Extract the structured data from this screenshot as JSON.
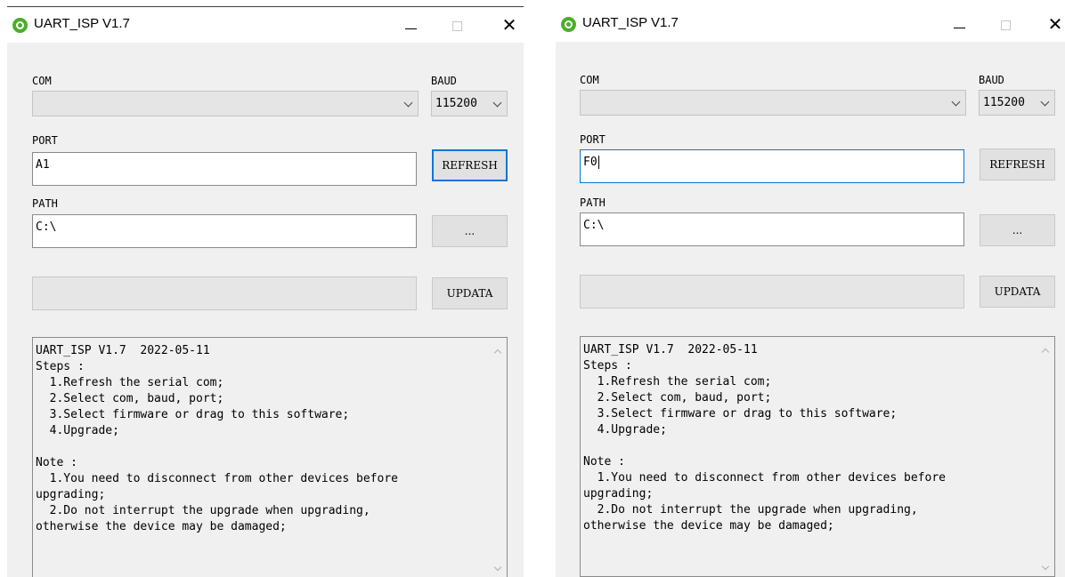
{
  "windows": [
    {
      "title": "UART_ISP V1.7",
      "com_label": "COM",
      "com_value": "",
      "baud_label": "BAUD",
      "baud_value": "115200",
      "port_label": "PORT",
      "port_value": "A1",
      "refresh_label": "REFRESH",
      "path_label": "PATH",
      "path_value": "C:\\",
      "browse_label": "...",
      "update_label": "UPDATA",
      "log": "UART_ISP V1.7  2022-05-11\nSteps :\n  1.Refresh the serial com;\n  2.Select com, baud, port;\n  3.Select firmware or drag to this software;\n  4.Upgrade;\n\nNote :\n  1.You need to disconnect from other devices before\nupgrading;\n  2.Do not interrupt the upgrade when upgrading,\notherwise the device may be damaged;"
    },
    {
      "title": "UART_ISP V1.7",
      "com_label": "COM",
      "com_value": "",
      "baud_label": "BAUD",
      "baud_value": "115200",
      "port_label": "PORT",
      "port_value": "F0",
      "refresh_label": "REFRESH",
      "path_label": "PATH",
      "path_value": "C:\\",
      "browse_label": "...",
      "update_label": "UPDATA",
      "log": "UART_ISP V1.7  2022-05-11\nSteps :\n  1.Refresh the serial com;\n  2.Select com, baud, port;\n  3.Select firmware or drag to this software;\n  4.Upgrade;\n\nNote :\n  1.You need to disconnect from other devices before\nupgrading;\n  2.Do not interrupt the upgrade when upgrading,\notherwise the device may be damaged;"
    }
  ],
  "colors": {
    "window_bg": "#f0f0f0",
    "focus_accent": "#0078d7",
    "app_icon": "#4cae2b"
  },
  "icons": {
    "app": "green-refresh-circle-icon",
    "minimize": "minimize-icon",
    "maximize": "maximize-icon",
    "close": "close-icon",
    "dropdown": "chevron-down-icon"
  },
  "progress": [
    0,
    0
  ]
}
